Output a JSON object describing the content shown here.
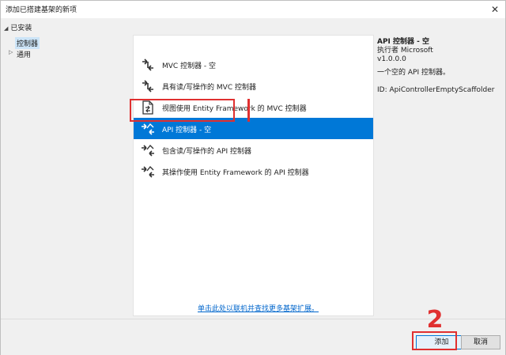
{
  "window": {
    "title": "添加已搭建基架的新项",
    "close_glyph": "✕"
  },
  "sidebar": {
    "installed_label": "已安装",
    "items": [
      {
        "label": "控制器",
        "selected": true
      },
      {
        "label": "通用",
        "selected": false
      }
    ]
  },
  "scaffolds": {
    "items": [
      {
        "label": "MVC 控制器 - 空",
        "icon": "controller-icon",
        "selected": false
      },
      {
        "label": "具有读/写操作的 MVC 控制器",
        "icon": "controller-icon",
        "selected": false
      },
      {
        "label": "视图使用 Entity Framework 的 MVC 控制器",
        "icon": "document-controller-icon",
        "selected": false
      },
      {
        "label": "API 控制器 - 空",
        "icon": "api-controller-icon",
        "selected": true
      },
      {
        "label": "包含读/写操作的 API 控制器",
        "icon": "api-controller-icon",
        "selected": false
      },
      {
        "label": "其操作使用 Entity Framework 的 API 控制器",
        "icon": "api-controller-icon",
        "selected": false
      }
    ]
  },
  "details": {
    "name": "API 控制器 - 空",
    "author": "执行者 Microsoft",
    "version": "v1.0.0.0",
    "description": "一个空的 API 控制器。",
    "id": "ID: ApiControllerEmptyScaffolder"
  },
  "online_link": "单击此处以联机并查找更多基架扩展。",
  "buttons": {
    "add": "添加",
    "cancel": "取消"
  },
  "annotation": {
    "step_number": "2"
  },
  "colors": {
    "selection": "#0078d7",
    "highlight": "#e03030",
    "link": "#0066cc"
  }
}
